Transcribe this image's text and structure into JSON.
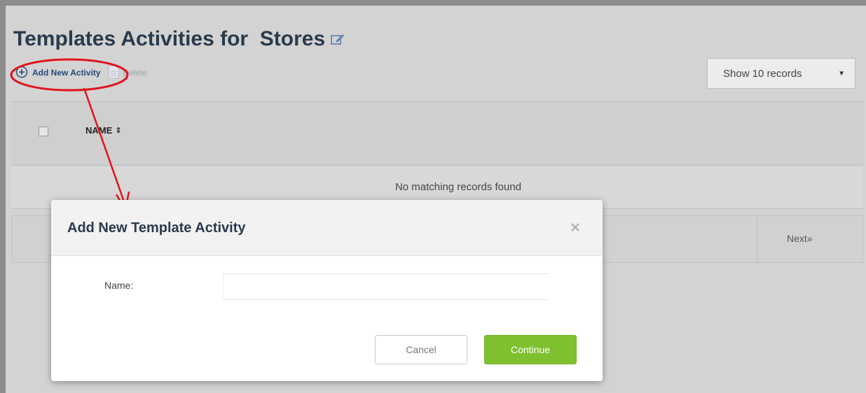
{
  "page": {
    "title": "Templates Activities for  Stores",
    "title_edit_icon": "pencil-square-icon"
  },
  "toolbar": {
    "add_label": "Add New Activity",
    "add_icon": "plus-circle-icon",
    "delete_label": "Delete",
    "delete_icon": "document-icon"
  },
  "records_select": {
    "selected": "Show 10 records",
    "arrow": "▼"
  },
  "table": {
    "columns": [
      {
        "label": "NAME",
        "sort_icon": "sort-icon",
        "sort_glyph": "⇕"
      }
    ],
    "empty_message": "No matching records found"
  },
  "pagination": {
    "next_label": "Next»"
  },
  "modal": {
    "title": "Add New Template Activity",
    "close_icon": "close-icon",
    "name_label": "Name:",
    "name_value": "",
    "cancel_label": "Cancel",
    "continue_label": "Continue"
  },
  "colors": {
    "annotation_red": "#e0141c",
    "continue_green": "#7fc02f",
    "title_navy": "#2a3a4c"
  }
}
